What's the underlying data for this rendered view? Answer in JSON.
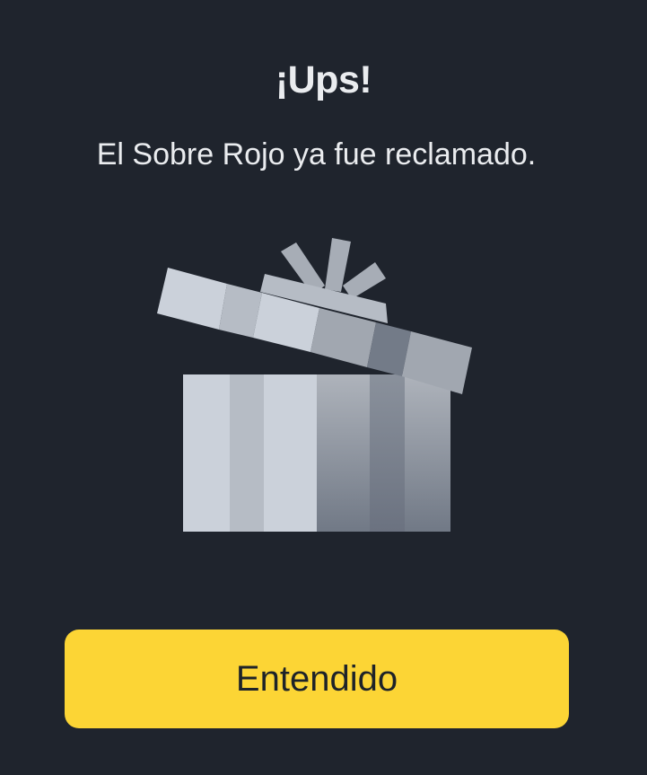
{
  "dialog": {
    "title": "¡Ups!",
    "message": "El Sobre Rojo ya fue reclamado.",
    "illustration": "open-gift-box-icon",
    "button_label": "Entendido"
  },
  "colors": {
    "background": "#1f242d",
    "text": "#eaecef",
    "button": "#fcd535",
    "button_text": "#1e2329"
  }
}
